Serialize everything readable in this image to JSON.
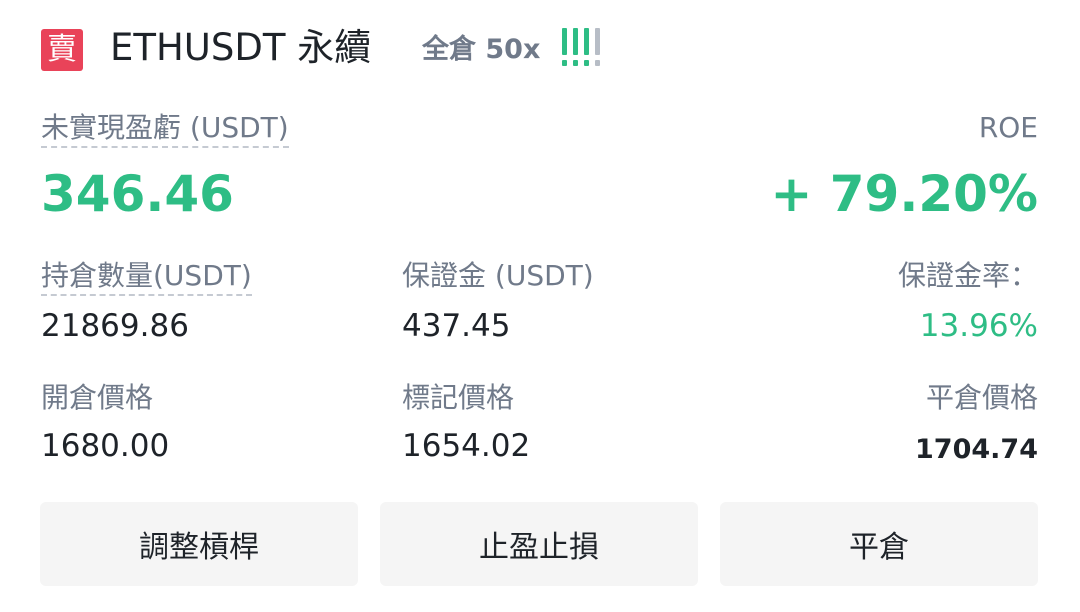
{
  "header": {
    "side_badge": "賣",
    "symbol": "ETHUSDT 永續",
    "margin_mode": "全倉 50x",
    "adl_indicator": {
      "icon": "adl-level-icon",
      "level": 4,
      "max_level": 5,
      "active_color": "#2ebd85",
      "inactive_color": "#b7bdc6"
    }
  },
  "pnl": {
    "label": "未實現盈虧 (USDT)",
    "value": "346.46",
    "roe_label": "ROE",
    "roe_value": "+ 79.20%"
  },
  "details": {
    "position_size_label": "持倉數量(USDT)",
    "position_size_value": "21869.86",
    "margin_label": "保證金 (USDT)",
    "margin_value": "437.45",
    "margin_ratio_label": "保證金率：",
    "margin_ratio_value": "13.96%",
    "entry_price_label": "開倉價格",
    "entry_price_value": "1680.00",
    "mark_price_label": "標記價格",
    "mark_price_value": "1654.02",
    "liq_price_label": "平倉價格",
    "liq_price_value": "1704.74"
  },
  "actions": {
    "adjust_leverage": "調整槓桿",
    "tp_sl": "止盈止損",
    "close_position": "平倉"
  },
  "colors": {
    "positive": "#2ebd85",
    "sell": "#e94359",
    "label": "#707a8a",
    "text": "#1e2329",
    "button_bg": "#f5f5f5"
  }
}
